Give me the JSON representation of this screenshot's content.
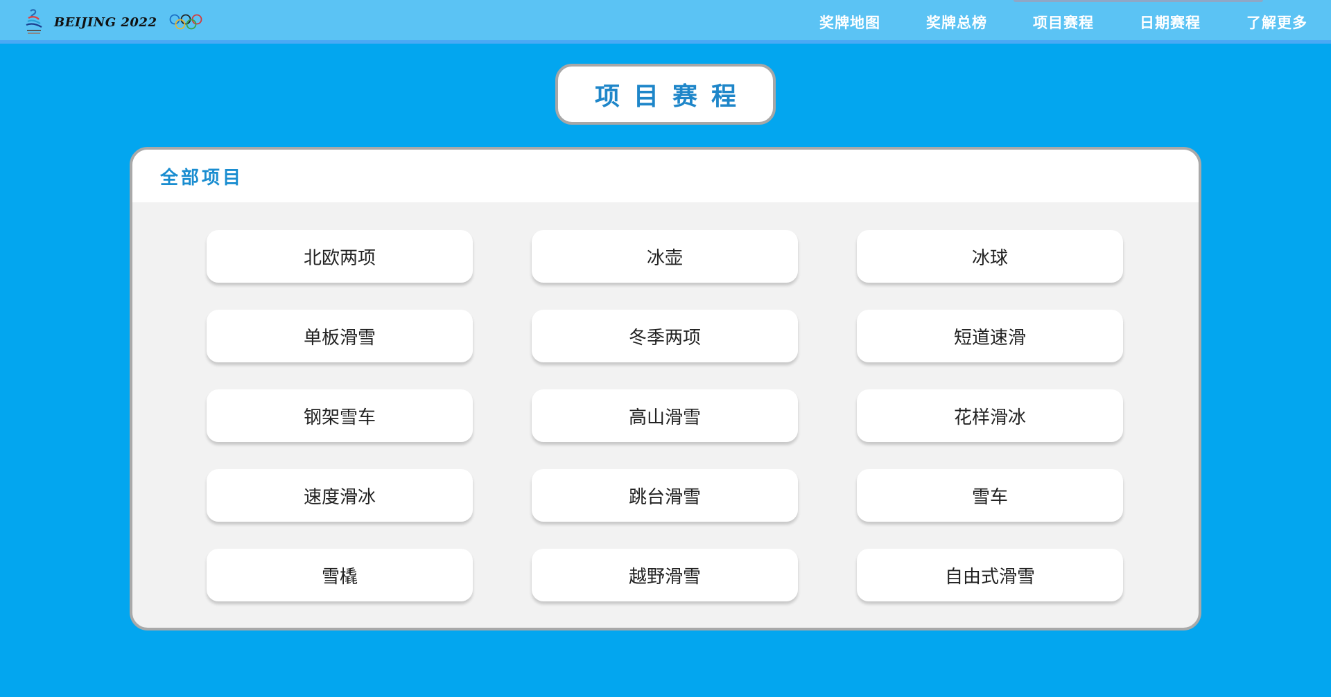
{
  "brand": {
    "wordmark": "BEIJING 2022",
    "emblem_icon": "beijing-2022-emblem",
    "rings_icon": "olympic-rings"
  },
  "nav": {
    "items": [
      {
        "label": "奖牌地图"
      },
      {
        "label": "奖牌总榜"
      },
      {
        "label": "项目赛程"
      },
      {
        "label": "日期赛程"
      },
      {
        "label": "了解更多"
      }
    ]
  },
  "page": {
    "title": "项目赛程"
  },
  "panel": {
    "header": "全部项目",
    "events": [
      "北欧两项",
      "冰壶",
      "冰球",
      "单板滑雪",
      "冬季两项",
      "短道速滑",
      "钢架雪车",
      "高山滑雪",
      "花样滑冰",
      "速度滑冰",
      "跳台滑雪",
      "雪车",
      "雪橇",
      "越野滑雪",
      "自由式滑雪"
    ]
  },
  "colors": {
    "background": "#03a6ef",
    "topbar": "#5bc3f4",
    "accent": "#1e86c9",
    "panel": "#f2f2f2",
    "button": "#ffffff"
  }
}
